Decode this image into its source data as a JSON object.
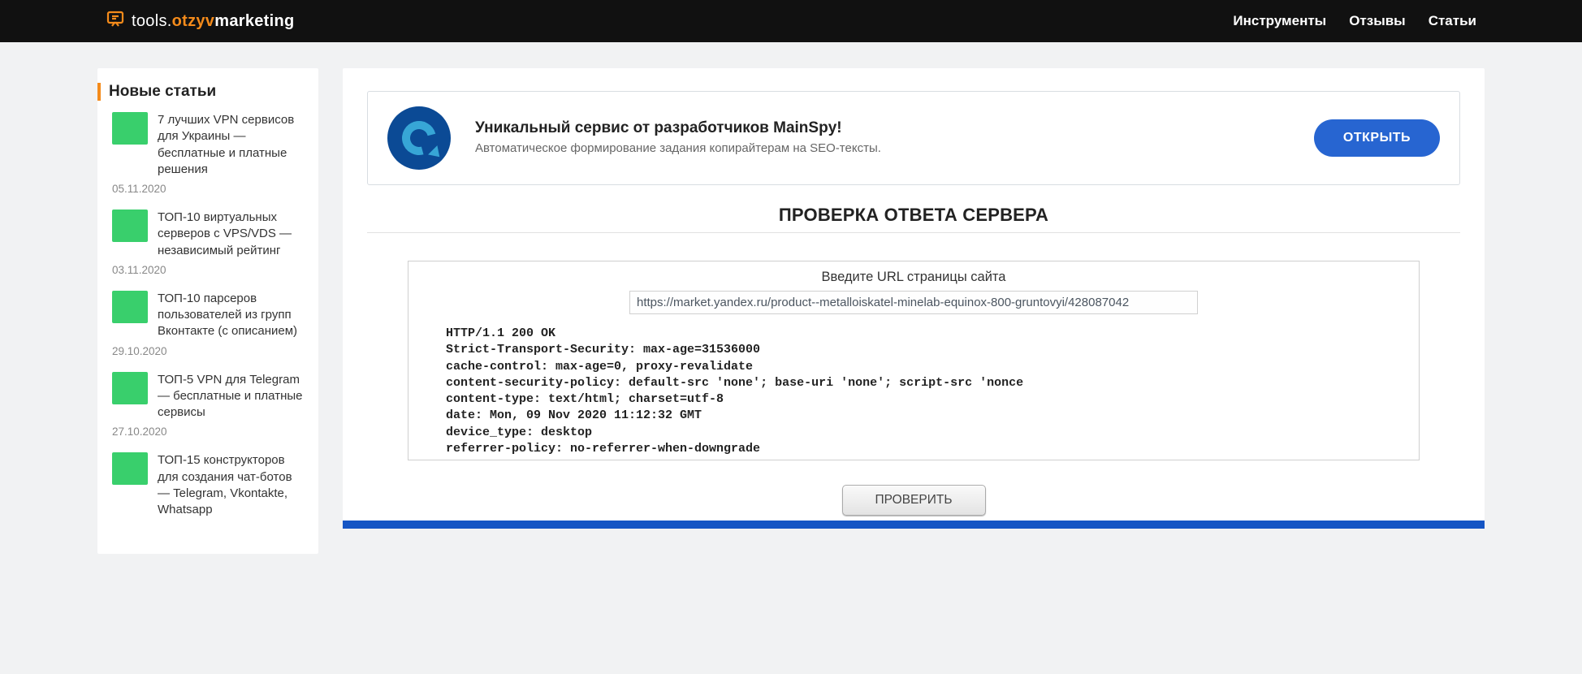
{
  "brand": {
    "part1": "tools.",
    "part2": "otzyv",
    "part3": "marketing"
  },
  "nav": [
    "Инструменты",
    "Отзывы",
    "Статьи"
  ],
  "sidebar": {
    "title": "Новые статьи",
    "items": [
      {
        "title": "7 лучших VPN сервисов для Украины — бесплатные и платные решения",
        "date": "05.11.2020"
      },
      {
        "title": "ТОП-10 виртуальных серверов с VPS/VDS — независимый рейтинг",
        "date": "03.11.2020"
      },
      {
        "title": "ТОП-10 парсеров пользователей из групп Вконтакте (с описанием)",
        "date": "29.10.2020"
      },
      {
        "title": "ТОП-5 VPN для Telegram — бесплатные и платные сервисы",
        "date": "27.10.2020"
      },
      {
        "title": "ТОП-15 конструкторов для создания чат-ботов — Telegram, Vkontakte, Whatsapp",
        "date": ""
      }
    ]
  },
  "promo": {
    "title": "Уникальный сервис от разработчиков MainSpy!",
    "sub": "Автоматическое формирование задания копирайтерам на SEO-тексты.",
    "button": "ОТКРЫТЬ"
  },
  "tool": {
    "heading": "ПРОВЕРКА ОТВЕТА СЕРВЕРА",
    "input_label": "Введите URL страницы сайта",
    "url_value": "https://market.yandex.ru/product--metalloiskatel-minelab-equinox-800-gruntovyi/428087042",
    "response": "HTTP/1.1 200 OK\nStrict-Transport-Security: max-age=31536000\ncache-control: max-age=0, proxy-revalidate\ncontent-security-policy: default-src 'none'; base-uri 'none'; script-src 'nonce\ncontent-type: text/html; charset=utf-8\ndate: Mon, 09 Nov 2020 11:12:32 GMT\ndevice_type: desktop\nreferrer-policy: no-referrer-when-downgrade\n                                                                                           ",
    "check_button": "ПРОВЕРИТЬ"
  }
}
